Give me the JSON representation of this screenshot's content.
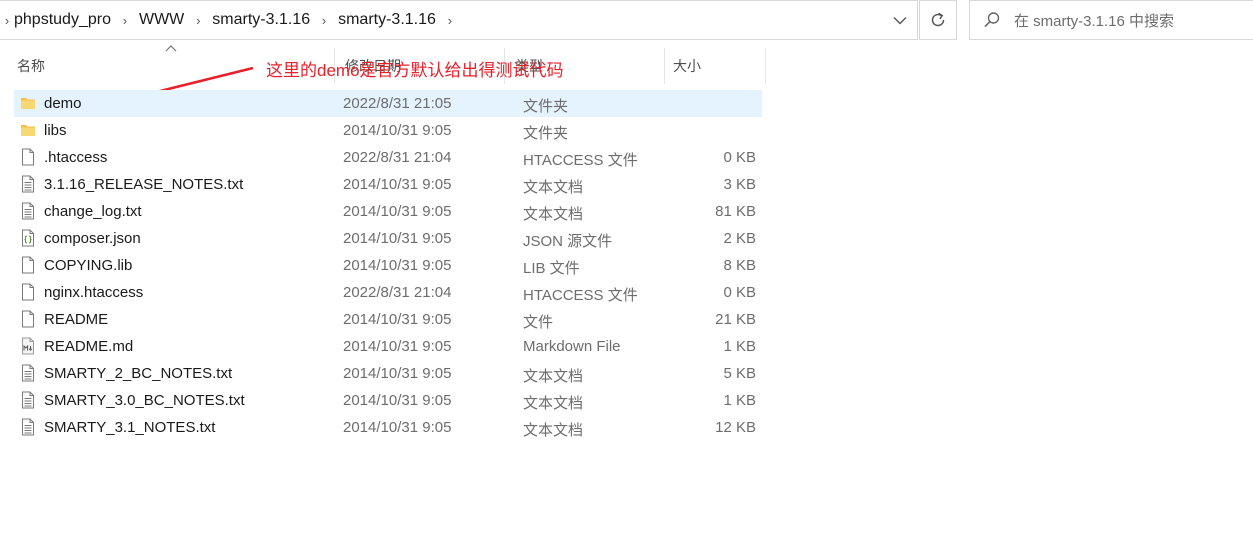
{
  "breadcrumb": [
    "phpstudy_pro",
    "WWW",
    "smarty-3.1.16",
    "smarty-3.1.16"
  ],
  "search": {
    "placeholder": "在 smarty-3.1.16 中搜索"
  },
  "columns": {
    "name": "名称",
    "date": "修改日期",
    "type": "类型",
    "size": "大小"
  },
  "annotation": "这里的demo是官方默认给出得测试代码",
  "colors": {
    "selected_row": "#e5f3ff",
    "annotation": "#e8202a",
    "folder": "#f3c24a"
  },
  "files": [
    {
      "name": "demo",
      "date": "2022/8/31 21:05",
      "type": "文件夹",
      "size": "",
      "icon": "folder-icon",
      "selected": true
    },
    {
      "name": "libs",
      "date": "2014/10/31 9:05",
      "type": "文件夹",
      "size": "",
      "icon": "folder-icon",
      "selected": false
    },
    {
      "name": ".htaccess",
      "date": "2022/8/31 21:04",
      "type": "HTACCESS 文件",
      "size": "0 KB",
      "icon": "file-icon",
      "selected": false
    },
    {
      "name": "3.1.16_RELEASE_NOTES.txt",
      "date": "2014/10/31 9:05",
      "type": "文本文档",
      "size": "3 KB",
      "icon": "text-file-icon",
      "selected": false
    },
    {
      "name": "change_log.txt",
      "date": "2014/10/31 9:05",
      "type": "文本文档",
      "size": "81 KB",
      "icon": "text-file-icon",
      "selected": false
    },
    {
      "name": "composer.json",
      "date": "2014/10/31 9:05",
      "type": "JSON 源文件",
      "size": "2 KB",
      "icon": "json-file-icon",
      "selected": false
    },
    {
      "name": "COPYING.lib",
      "date": "2014/10/31 9:05",
      "type": "LIB 文件",
      "size": "8 KB",
      "icon": "file-icon",
      "selected": false
    },
    {
      "name": "nginx.htaccess",
      "date": "2022/8/31 21:04",
      "type": "HTACCESS 文件",
      "size": "0 KB",
      "icon": "file-icon",
      "selected": false
    },
    {
      "name": "README",
      "date": "2014/10/31 9:05",
      "type": "文件",
      "size": "21 KB",
      "icon": "file-icon",
      "selected": false
    },
    {
      "name": "README.md",
      "date": "2014/10/31 9:05",
      "type": "Markdown File",
      "size": "1 KB",
      "icon": "markdown-file-icon",
      "selected": false
    },
    {
      "name": "SMARTY_2_BC_NOTES.txt",
      "date": "2014/10/31 9:05",
      "type": "文本文档",
      "size": "5 KB",
      "icon": "text-file-icon",
      "selected": false
    },
    {
      "name": "SMARTY_3.0_BC_NOTES.txt",
      "date": "2014/10/31 9:05",
      "type": "文本文档",
      "size": "1 KB",
      "icon": "text-file-icon",
      "selected": false
    },
    {
      "name": "SMARTY_3.1_NOTES.txt",
      "date": "2014/10/31 9:05",
      "type": "文本文档",
      "size": "12 KB",
      "icon": "text-file-icon",
      "selected": false
    }
  ]
}
